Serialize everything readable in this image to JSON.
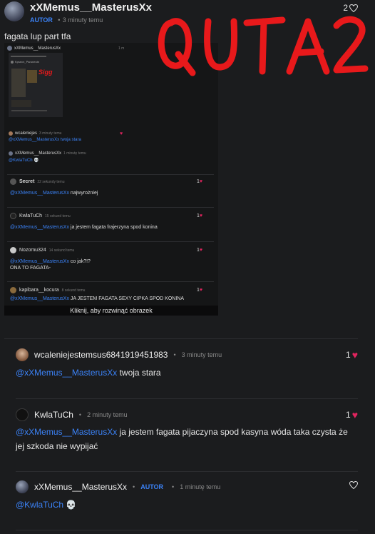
{
  "post": {
    "author": "xXMemus__MasterusXx",
    "badge": "AUTOR",
    "time": "3 minuty temu",
    "like_count": "2",
    "text": "fagata lup part tfa",
    "image_caption": "Kliknij, aby rozwinąć obrazek",
    "overlay_text": "QUTA2"
  },
  "embedded": {
    "header_name": "xXMemus__MasterusXx",
    "header_meta": "1 m",
    "inner_name": "Kpsecn_Paruneutn",
    "stamp": "Sigg",
    "c1_name": "wcaleniejes",
    "c1_time": "3 minuty temu",
    "c1_text": "@xXMemus__MasterusXx twoja stara",
    "c2_name": "xXMemus__MasterusXx",
    "c2_time": "1 minutę temu",
    "c2_text": "@KwlaTuCh 💀",
    "rows": [
      {
        "name": "Secret",
        "time": "22 sekundy temu",
        "mention": "@xXMemus__MasterusXx",
        "text": "najwyrożniej",
        "likes": "1"
      },
      {
        "name": "KwlaTuCh",
        "time": "15 sekund temu",
        "mention": "@xXMemus__MasterusXx",
        "text": "ja jestem fagata frajerzyna spod konina",
        "likes": "1"
      },
      {
        "name": "Nozomu324",
        "time": "14 sekund temu",
        "mention": "@xXMemus__MasterusXx",
        "text": "co jak?!?",
        "extra": "ONA TO FAGATA-",
        "likes": "1"
      },
      {
        "name": "kapibara__kocura",
        "time": "8 sekund temu",
        "mention": "@xXMemus__MasterusXx",
        "text": "JA JESTEM FAGATA SEXY CIPKA SPOD KONINA",
        "likes": "1"
      }
    ]
  },
  "comments": [
    {
      "name": "wcaleniejestemsus6841919451983",
      "time": "3 minuty temu",
      "mention": "@xXMemus__MasterusXx",
      "text": " twoja stara",
      "likes": "1"
    },
    {
      "name": "KwlaTuCh",
      "time": "2 minuty temu",
      "mention": "@xXMemus__MasterusXx",
      "text": " ja jestem fagata pijaczyna spod kasyna wóda taka czysta że jej szkoda nie wypijać",
      "likes": "1"
    },
    {
      "name": "xXMemus__MasterusXx",
      "badge": "AUTOR",
      "time": "1 minutę temu",
      "mention": "@KwlaTuCh",
      "text": " 💀"
    }
  ],
  "icons": {
    "heart": "heart-icon",
    "heart_filled": "heart-filled-icon"
  },
  "colors": {
    "background": "#1b1c1e",
    "accent_blue": "#3b82f6",
    "heart_red": "#e0245e",
    "overlay_red": "#e8191b"
  }
}
